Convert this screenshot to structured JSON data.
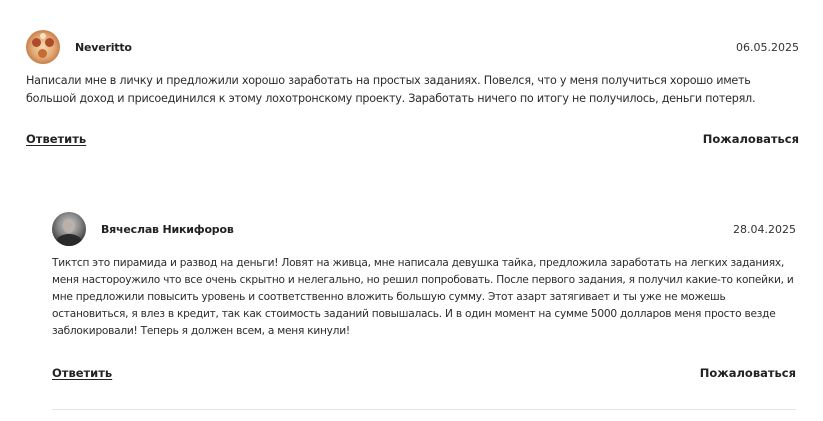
{
  "comments": [
    {
      "author": "Neveritto",
      "date": "06.05.2025",
      "avatar_icon": "ornament-avatar-icon",
      "text": "Написали мне в личку и предложили хорошо заработать на простых заданиях. Повелся, что у меня получиться хорошо иметь большой доход и присоединился к этому лохотронскому проекту. Заработать ничего по итогу не получилось, деньги потерял.",
      "reply_label": "Ответить",
      "report_label": "Пожаловаться"
    },
    {
      "author": "Вячеслав Никифоров",
      "date": "28.04.2025",
      "avatar_icon": "user-photo-avatar-icon",
      "text": "Тиктсп это пирамида и развод на деньги! Ловят на живца, мне написала девушка тайка, предложила заработать на легких заданиях, меня настороужило что все очень скрытно и нелегально, но решил попробовать. После первого задания, я получил какие-то копейки, и мне предложили повысить уровень и соответственно вложить большую сумму. Этот азарт затягивает и ты уже не можешь остановиться, я влез в кредит, так как стоимость заданий повышалась. И в один момент на сумме 5000 долларов меня просто везде заблокировали! Теперь я должен всем, а меня кинули!",
      "reply_label": "Ответить",
      "report_label": "Пожаловаться"
    }
  ]
}
